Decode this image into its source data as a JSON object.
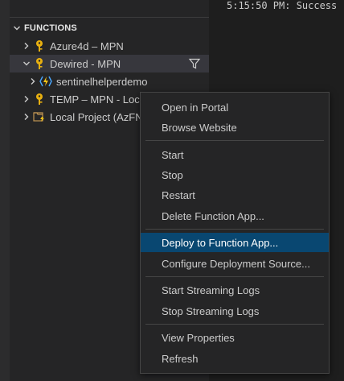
{
  "output": {
    "text": "5:15:50 PM: Success"
  },
  "sidebar": {
    "section_title": "FUNCTIONS",
    "items": [
      {
        "label": "Azure4d – MPN"
      },
      {
        "label": "Dewired - MPN"
      },
      {
        "label": "sentinelhelperdemo"
      },
      {
        "label": "TEMP – MPN - Loc"
      },
      {
        "label": "Local Project (AzFN"
      }
    ]
  },
  "context_menu": {
    "items": [
      {
        "label": "Open in Portal"
      },
      {
        "label": "Browse Website"
      },
      {
        "label": "Start"
      },
      {
        "label": "Stop"
      },
      {
        "label": "Restart"
      },
      {
        "label": "Delete Function App..."
      },
      {
        "label": "Deploy to Function App..."
      },
      {
        "label": "Configure Deployment Source..."
      },
      {
        "label": "Start Streaming Logs"
      },
      {
        "label": "Stop Streaming Logs"
      },
      {
        "label": "View Properties"
      },
      {
        "label": "Refresh"
      }
    ],
    "highlighted_item": "Deploy to Function App..."
  },
  "colors": {
    "highlight": "#094771",
    "key_icon": "#e8b010",
    "function_icon": "#4aa8ff"
  }
}
